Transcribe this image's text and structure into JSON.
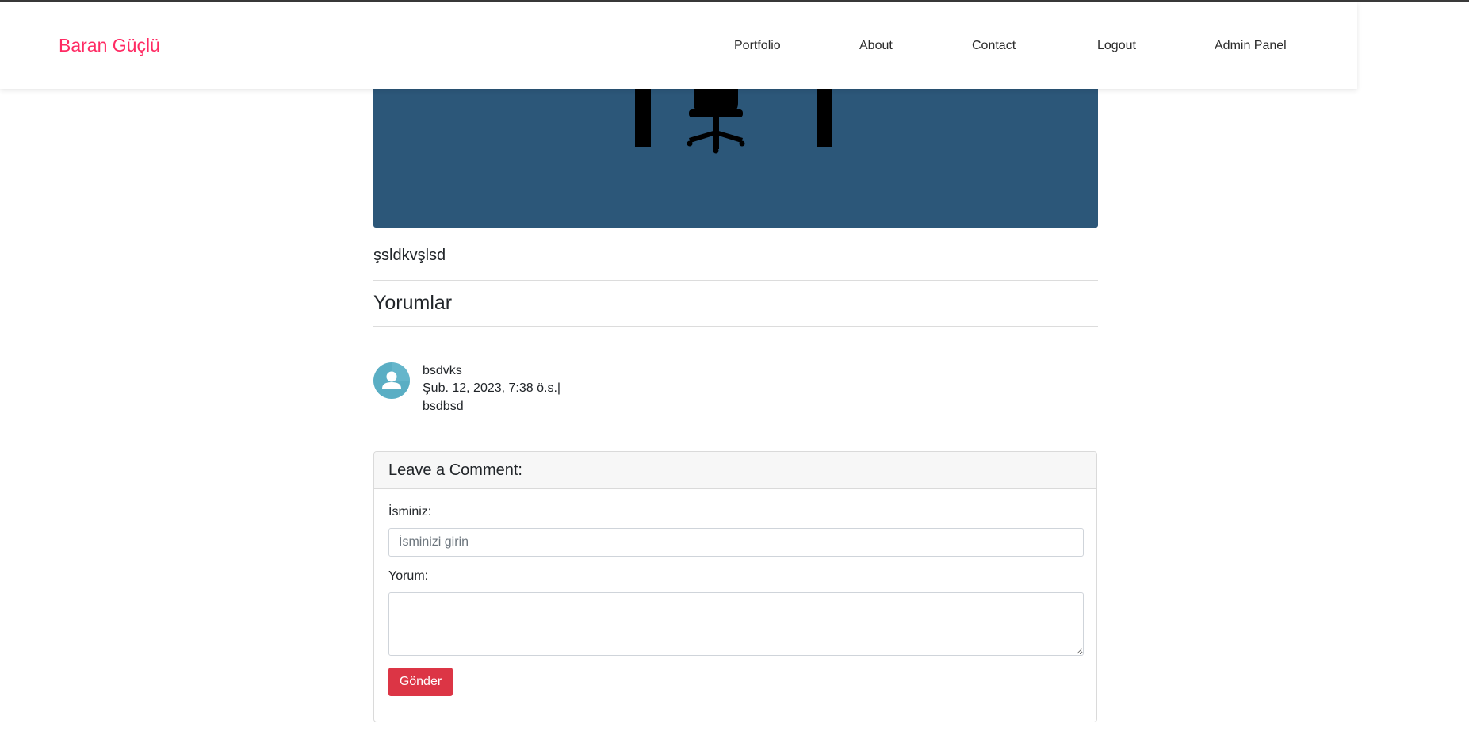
{
  "navbar": {
    "brand": "Baran Güçlü",
    "links": [
      "Portfolio",
      "About",
      "Contact",
      "Logout",
      "Admin Panel"
    ]
  },
  "hero": {
    "background_color": "#2c5779",
    "icon": "office-chair-desk-icon"
  },
  "post": {
    "body": "şsldkvşlsd"
  },
  "comments": {
    "title": "Yorumlar",
    "items": [
      {
        "avatar_icon": "user-avatar-icon",
        "author": "bsdvks",
        "date": "Şub. 12, 2023, 7:38 ö.s.|",
        "body": "bsdbsd"
      }
    ]
  },
  "comment_form": {
    "header": "Leave a Comment:",
    "name_label": "İsminiz:",
    "name_value": "",
    "name_placeholder": "İsminizi girin",
    "comment_label": "Yorum:",
    "comment_value": "",
    "submit_label": "Gönder"
  },
  "colors": {
    "brand": "#ff2a63",
    "submit_button": "#dc3545",
    "avatar": "#5aaec4"
  }
}
